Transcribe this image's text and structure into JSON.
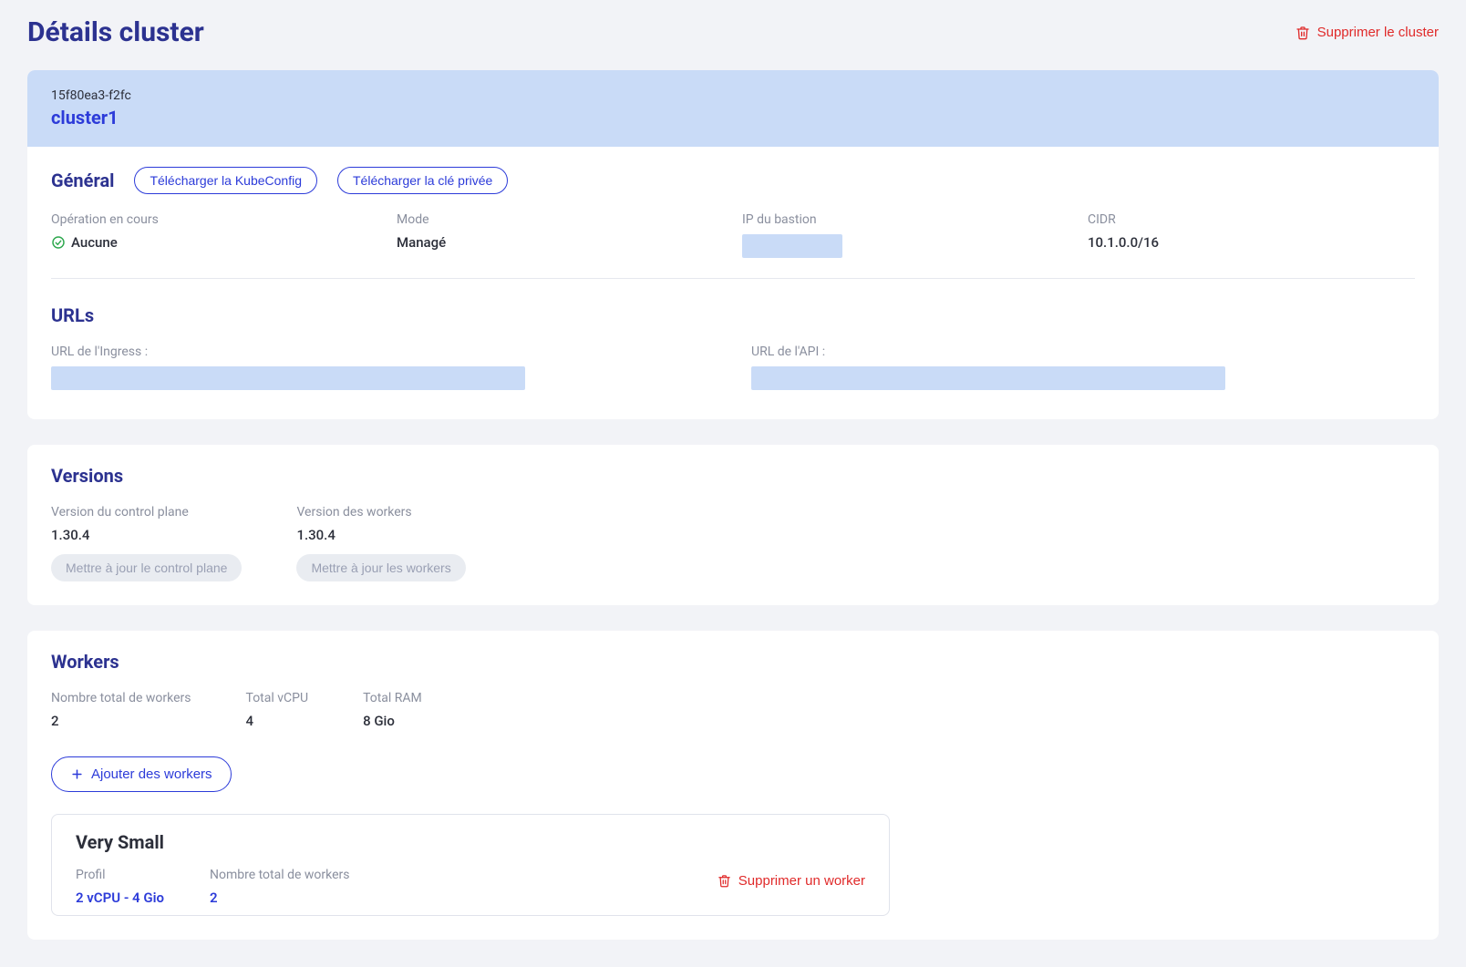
{
  "header": {
    "title": "Détails cluster",
    "delete_cluster_label": "Supprimer le cluster"
  },
  "cluster": {
    "id": "15f80ea3-f2fc",
    "name": "cluster1"
  },
  "general": {
    "section_title": "Général",
    "download_kubeconfig_label": "Télécharger la KubeConfig",
    "download_private_key_label": "Télécharger la clé privée",
    "operation_label": "Opération en cours",
    "operation_value": "Aucune",
    "mode_label": "Mode",
    "mode_value": "Managé",
    "bastion_ip_label": "IP du bastion",
    "bastion_ip_value": "",
    "cidr_label": "CIDR",
    "cidr_value": "10.1.0.0/16"
  },
  "urls": {
    "section_title": "URLs",
    "ingress_label": "URL de l'Ingress :",
    "ingress_value": "",
    "api_label": "URL de l'API :",
    "api_value": ""
  },
  "versions": {
    "section_title": "Versions",
    "control_plane_label": "Version du control plane",
    "control_plane_value": "1.30.4",
    "update_control_plane_label": "Mettre à jour le control plane",
    "workers_label": "Version des workers",
    "workers_value": "1.30.4",
    "update_workers_label": "Mettre à jour les workers"
  },
  "workers": {
    "section_title": "Workers",
    "total_workers_label": "Nombre total de workers",
    "total_workers_value": "2",
    "total_vcpu_label": "Total vCPU",
    "total_vcpu_value": "4",
    "total_ram_label": "Total RAM",
    "total_ram_value": "8 Gio",
    "add_workers_label": "Ajouter des workers",
    "pool": {
      "name": "Very Small",
      "profile_label": "Profil",
      "profile_value": "2 vCPU - 4 Gio",
      "count_label": "Nombre total de workers",
      "count_value": "2",
      "delete_worker_label": "Supprimer un worker"
    }
  }
}
